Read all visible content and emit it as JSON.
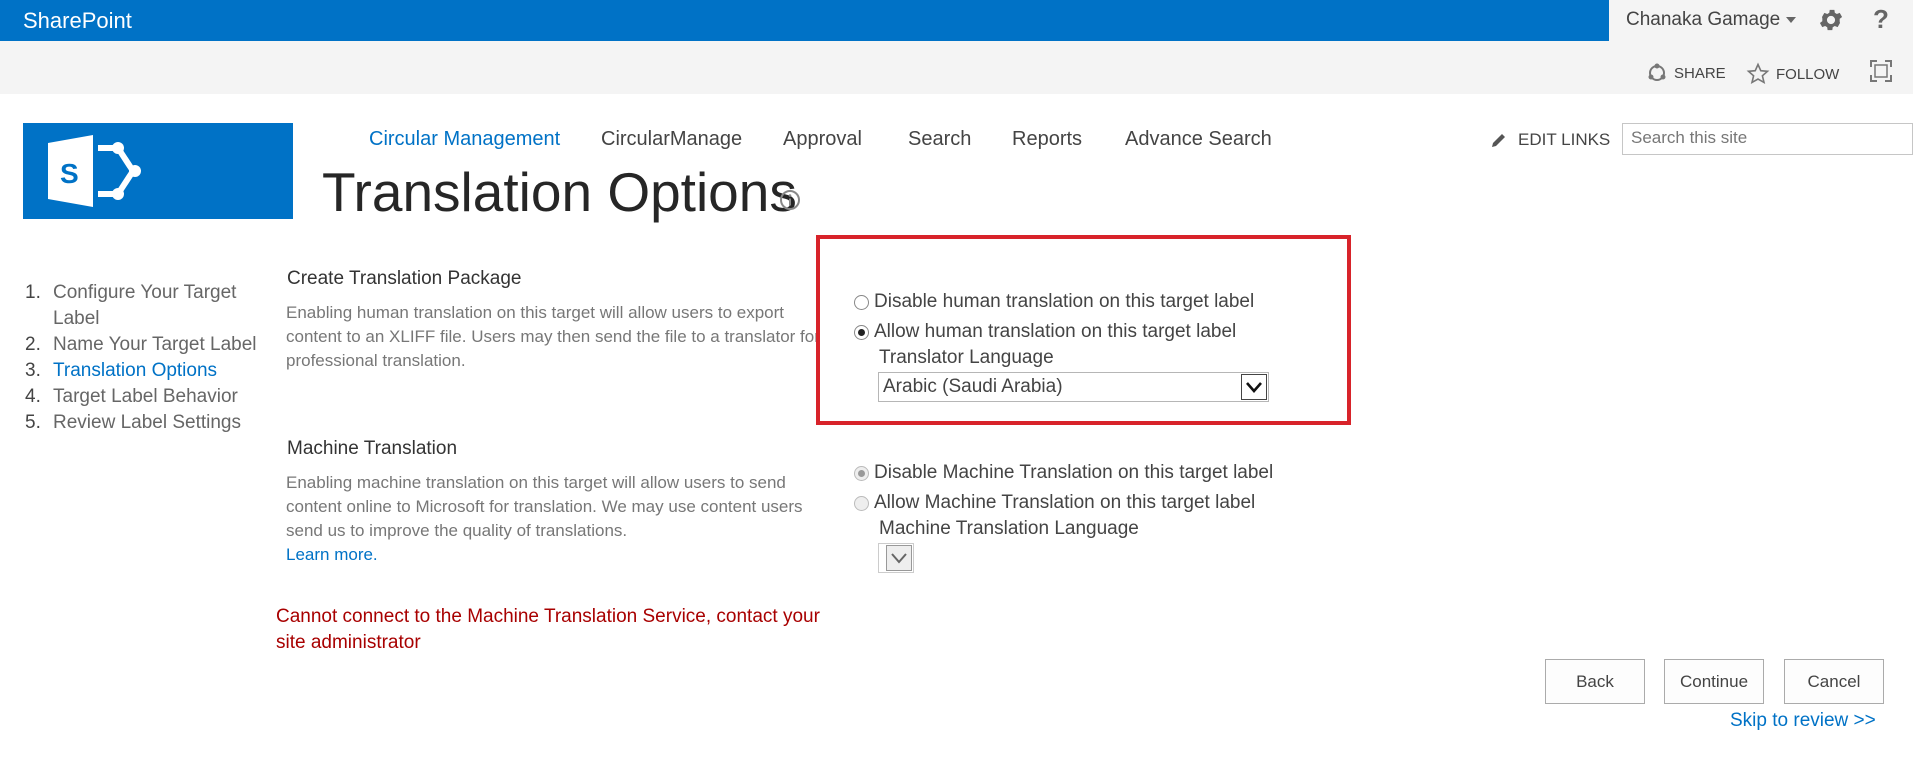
{
  "suite_bar": {
    "brand": "SharePoint",
    "user_name": "Chanaka Gamage",
    "accent": "#0072c6"
  },
  "actions": {
    "share": "SHARE",
    "follow": "FOLLOW"
  },
  "nav": {
    "items": [
      "Circular Management",
      "CircularManage",
      "Approval",
      "Search",
      "Reports",
      "Advance Search"
    ],
    "selected_index": 0,
    "edit_links": "EDIT LINKS",
    "search_placeholder": "Search this site"
  },
  "page": {
    "title": "Translation Options"
  },
  "steps": [
    {
      "num": "1.",
      "label": "Configure Your Target Label"
    },
    {
      "num": "2.",
      "label": "Name Your Target Label"
    },
    {
      "num": "3.",
      "label": "Translation Options"
    },
    {
      "num": "4.",
      "label": "Target Label Behavior"
    },
    {
      "num": "5.",
      "label": "Review Label Settings"
    }
  ],
  "current_step": 3,
  "human": {
    "heading": "Create Translation Package",
    "description": "Enabling human translation on this target will allow users to export content to an XLIFF file. Users may then send the file to a translator for professional translation.",
    "option_disable": "Disable human translation on this target label",
    "option_allow": "Allow human translation on this target label",
    "selected": "allow",
    "language_label": "Translator Language",
    "language_value": "Arabic (Saudi Arabia)"
  },
  "machine": {
    "heading": "Machine Translation",
    "description": "Enabling machine translation on this target will allow users to send content online to Microsoft for translation. We may use content users send us to improve the quality of translations.",
    "learn_more": "Learn more.",
    "option_disable": "Disable Machine Translation on this target label",
    "option_allow": "Allow Machine Translation on this target label",
    "selected": "disable",
    "enabled": false,
    "language_label": "Machine Translation Language",
    "language_value": ""
  },
  "error": "Cannot connect to the Machine Translation Service, contact your site administrator",
  "buttons": {
    "back": "Back",
    "continue": "Continue",
    "cancel": "Cancel"
  },
  "skip_link": "Skip to review >>",
  "colors": {
    "error": "#a80000",
    "highlight_box": "#d8232a",
    "link": "#0072c6"
  }
}
